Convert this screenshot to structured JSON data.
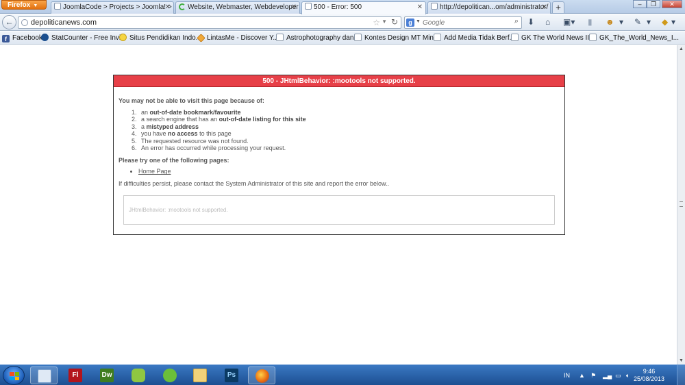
{
  "browser": {
    "menu_button": "Firefox",
    "tabs": [
      {
        "label": "JoomlaCode > Projects > Joomla! > R...",
        "icon": "page-icon"
      },
      {
        "label": "Website, Webmaster, Webdeveloper |...",
        "icon": "loading-spinner-icon"
      },
      {
        "label": "500 - Error: 500",
        "icon": "page-icon",
        "active": true
      },
      {
        "label": "http://depolitican...om/administrator/",
        "icon": "page-icon"
      }
    ],
    "new_tab": "+",
    "url": "depoliticanews.com",
    "search_placeholder": "Google",
    "bookmarks": [
      "Facebook",
      "StatCounter - Free Invi...",
      "Situs Pendidikan Indo...",
      "LintasMe - Discover Y...",
      "Astrophotography dan...",
      "Kontes Design MT Min...",
      "Add Media Tidak Berf...",
      "GK The World News II ...",
      "GK_The_World_News_I..."
    ]
  },
  "error_page": {
    "header": "500 - JHtmlBehavior: :mootools not supported.",
    "lead": "You may not be able to visit this page because of:",
    "reasons": [
      {
        "pre": "an ",
        "bold": "out-of-date bookmark/favourite",
        "post": ""
      },
      {
        "pre": "a search engine that has an ",
        "bold": "out-of-date listing for this site",
        "post": ""
      },
      {
        "pre": "a ",
        "bold": "mistyped address",
        "post": ""
      },
      {
        "pre": "you have ",
        "bold": "no access",
        "post": " to this page"
      },
      {
        "pre": "The requested resource was not found.",
        "bold": "",
        "post": ""
      },
      {
        "pre": "An error has occurred while processing your request.",
        "bold": "",
        "post": ""
      }
    ],
    "try_heading": "Please try one of the following pages:",
    "home_link": "Home Page",
    "persist_text": "If difficulties persist, please contact the System Administrator of this site and report the error below..",
    "error_message": "JHtmlBehavior: :mootools not supported."
  },
  "taskbar": {
    "apps": [
      "Windows Explorer",
      "Flash",
      "Dreamweaver",
      "Application",
      "Cheetah",
      "Folder",
      "Photoshop",
      "Firefox"
    ],
    "app_letters": {
      "flash": "Fl",
      "dreamweaver": "Dw",
      "photoshop": "Ps"
    },
    "language": "IN",
    "time": "9:46",
    "date": "25/08/2013"
  },
  "colors": {
    "error_header": "#e74048",
    "taskbar": "#1d4f92",
    "firefox_button": "#e2710f"
  }
}
